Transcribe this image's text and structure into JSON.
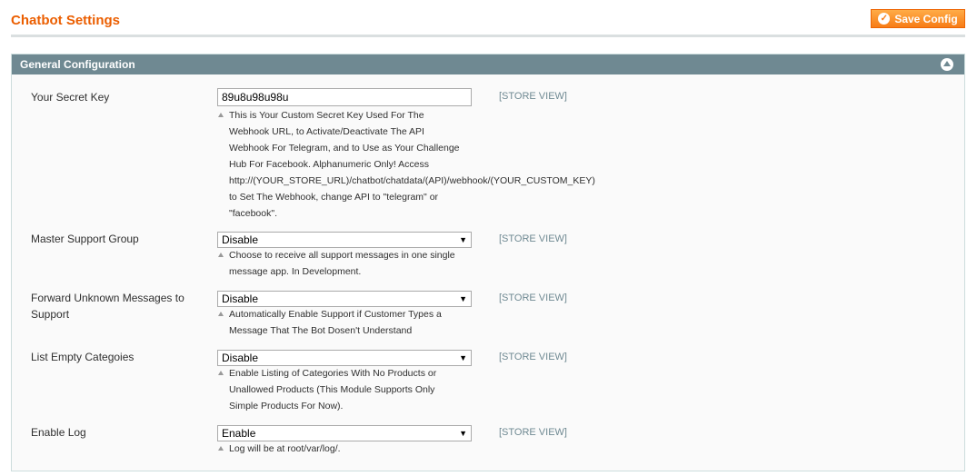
{
  "header": {
    "title": "Chatbot Settings",
    "save_label": "Save Config"
  },
  "section": {
    "title": "General Configuration"
  },
  "fields": [
    {
      "label": "Your Secret Key",
      "value": "89u8u98u98u",
      "scope": "[STORE VIEW]",
      "note": "This is Your Custom Secret Key Used For The\nWebhook URL, to Activate/Deactivate The API\nWebhook For Telegram, and to Use as Your Challenge\nHub For Facebook. Alphanumeric Only! Access\nhttp://(YOUR_STORE_URL)/chatbot/chatdata/(API)/webhook/(YOUR_CUSTOM_KEY)\nto Set The Webhook, change API to \"telegram\" or\n\"facebook\"."
    },
    {
      "label": "Master Support Group",
      "value": "Disable",
      "scope": "[STORE VIEW]",
      "note": "Choose to receive all support messages in one single\nmessage app. In Development."
    },
    {
      "label": "Forward Unknown Messages to\nSupport",
      "value": "Disable",
      "scope": "[STORE VIEW]",
      "note": "Automatically Enable Support if Customer Types a\nMessage That The Bot Dosen't Understand"
    },
    {
      "label": "List Empty Categoies",
      "value": "Disable",
      "scope": "[STORE VIEW]",
      "note": "Enable Listing of Categories With No Products or\nUnallowed Products (This Module Supports Only\nSimple Products For Now)."
    },
    {
      "label": "Enable Log",
      "value": "Enable",
      "scope": "[STORE VIEW]",
      "note": "Log will be at root/var/log/."
    }
  ],
  "icons": {
    "save": "check-circle-icon",
    "collapse": "collapse-up-icon",
    "select_arrow": "dropdown-arrow-icon",
    "note": "note-triangle-icon"
  },
  "colors": {
    "title": "#eb5e00",
    "button": "#f77c16",
    "section_header": "#6f8992",
    "scope_text": "#6f8992"
  }
}
